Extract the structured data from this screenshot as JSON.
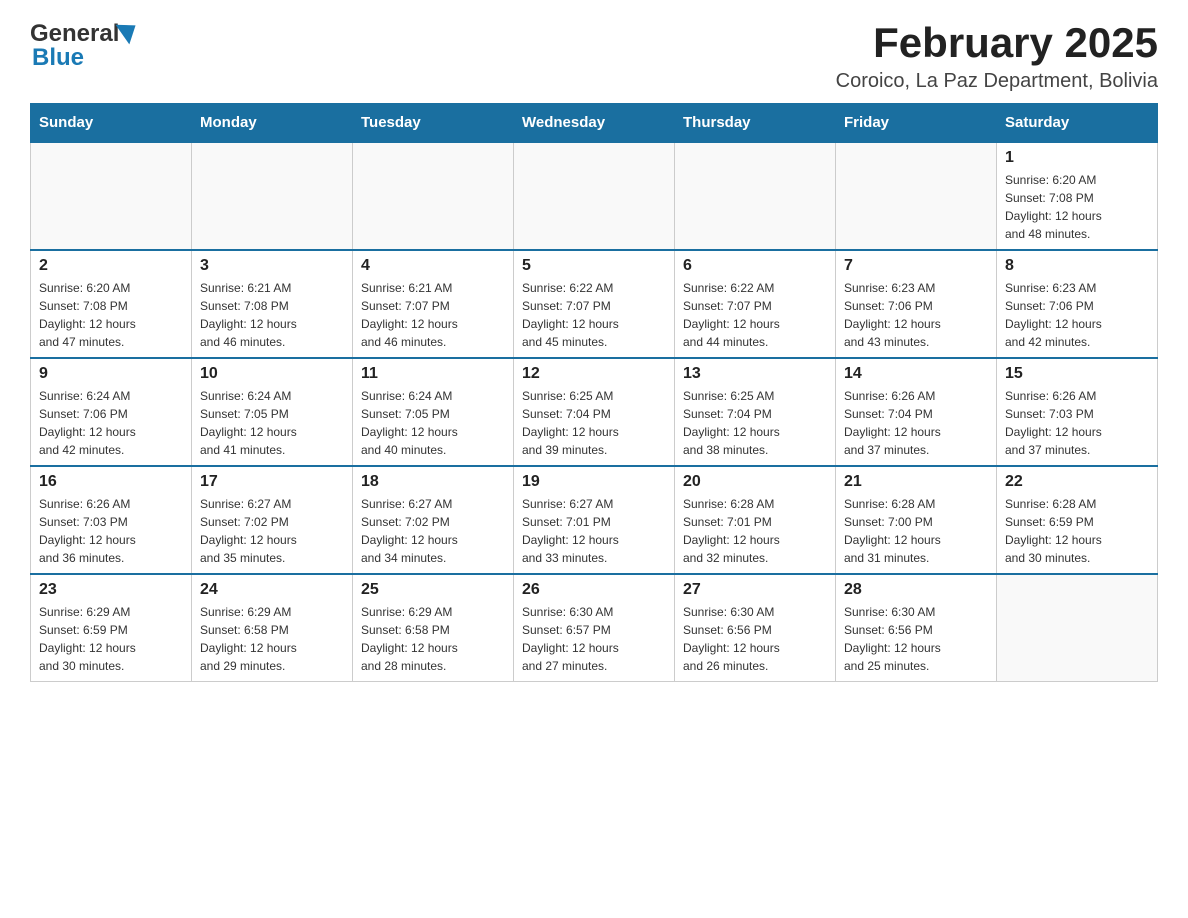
{
  "header": {
    "title": "February 2025",
    "subtitle": "Coroico, La Paz Department, Bolivia"
  },
  "logo": {
    "general": "General",
    "blue": "Blue"
  },
  "days_of_week": [
    "Sunday",
    "Monday",
    "Tuesday",
    "Wednesday",
    "Thursday",
    "Friday",
    "Saturday"
  ],
  "weeks": [
    {
      "days": [
        {
          "number": "",
          "info": ""
        },
        {
          "number": "",
          "info": ""
        },
        {
          "number": "",
          "info": ""
        },
        {
          "number": "",
          "info": ""
        },
        {
          "number": "",
          "info": ""
        },
        {
          "number": "",
          "info": ""
        },
        {
          "number": "1",
          "info": "Sunrise: 6:20 AM\nSunset: 7:08 PM\nDaylight: 12 hours\nand 48 minutes."
        }
      ]
    },
    {
      "days": [
        {
          "number": "2",
          "info": "Sunrise: 6:20 AM\nSunset: 7:08 PM\nDaylight: 12 hours\nand 47 minutes."
        },
        {
          "number": "3",
          "info": "Sunrise: 6:21 AM\nSunset: 7:08 PM\nDaylight: 12 hours\nand 46 minutes."
        },
        {
          "number": "4",
          "info": "Sunrise: 6:21 AM\nSunset: 7:07 PM\nDaylight: 12 hours\nand 46 minutes."
        },
        {
          "number": "5",
          "info": "Sunrise: 6:22 AM\nSunset: 7:07 PM\nDaylight: 12 hours\nand 45 minutes."
        },
        {
          "number": "6",
          "info": "Sunrise: 6:22 AM\nSunset: 7:07 PM\nDaylight: 12 hours\nand 44 minutes."
        },
        {
          "number": "7",
          "info": "Sunrise: 6:23 AM\nSunset: 7:06 PM\nDaylight: 12 hours\nand 43 minutes."
        },
        {
          "number": "8",
          "info": "Sunrise: 6:23 AM\nSunset: 7:06 PM\nDaylight: 12 hours\nand 42 minutes."
        }
      ]
    },
    {
      "days": [
        {
          "number": "9",
          "info": "Sunrise: 6:24 AM\nSunset: 7:06 PM\nDaylight: 12 hours\nand 42 minutes."
        },
        {
          "number": "10",
          "info": "Sunrise: 6:24 AM\nSunset: 7:05 PM\nDaylight: 12 hours\nand 41 minutes."
        },
        {
          "number": "11",
          "info": "Sunrise: 6:24 AM\nSunset: 7:05 PM\nDaylight: 12 hours\nand 40 minutes."
        },
        {
          "number": "12",
          "info": "Sunrise: 6:25 AM\nSunset: 7:04 PM\nDaylight: 12 hours\nand 39 minutes."
        },
        {
          "number": "13",
          "info": "Sunrise: 6:25 AM\nSunset: 7:04 PM\nDaylight: 12 hours\nand 38 minutes."
        },
        {
          "number": "14",
          "info": "Sunrise: 6:26 AM\nSunset: 7:04 PM\nDaylight: 12 hours\nand 37 minutes."
        },
        {
          "number": "15",
          "info": "Sunrise: 6:26 AM\nSunset: 7:03 PM\nDaylight: 12 hours\nand 37 minutes."
        }
      ]
    },
    {
      "days": [
        {
          "number": "16",
          "info": "Sunrise: 6:26 AM\nSunset: 7:03 PM\nDaylight: 12 hours\nand 36 minutes."
        },
        {
          "number": "17",
          "info": "Sunrise: 6:27 AM\nSunset: 7:02 PM\nDaylight: 12 hours\nand 35 minutes."
        },
        {
          "number": "18",
          "info": "Sunrise: 6:27 AM\nSunset: 7:02 PM\nDaylight: 12 hours\nand 34 minutes."
        },
        {
          "number": "19",
          "info": "Sunrise: 6:27 AM\nSunset: 7:01 PM\nDaylight: 12 hours\nand 33 minutes."
        },
        {
          "number": "20",
          "info": "Sunrise: 6:28 AM\nSunset: 7:01 PM\nDaylight: 12 hours\nand 32 minutes."
        },
        {
          "number": "21",
          "info": "Sunrise: 6:28 AM\nSunset: 7:00 PM\nDaylight: 12 hours\nand 31 minutes."
        },
        {
          "number": "22",
          "info": "Sunrise: 6:28 AM\nSunset: 6:59 PM\nDaylight: 12 hours\nand 30 minutes."
        }
      ]
    },
    {
      "days": [
        {
          "number": "23",
          "info": "Sunrise: 6:29 AM\nSunset: 6:59 PM\nDaylight: 12 hours\nand 30 minutes."
        },
        {
          "number": "24",
          "info": "Sunrise: 6:29 AM\nSunset: 6:58 PM\nDaylight: 12 hours\nand 29 minutes."
        },
        {
          "number": "25",
          "info": "Sunrise: 6:29 AM\nSunset: 6:58 PM\nDaylight: 12 hours\nand 28 minutes."
        },
        {
          "number": "26",
          "info": "Sunrise: 6:30 AM\nSunset: 6:57 PM\nDaylight: 12 hours\nand 27 minutes."
        },
        {
          "number": "27",
          "info": "Sunrise: 6:30 AM\nSunset: 6:56 PM\nDaylight: 12 hours\nand 26 minutes."
        },
        {
          "number": "28",
          "info": "Sunrise: 6:30 AM\nSunset: 6:56 PM\nDaylight: 12 hours\nand 25 minutes."
        },
        {
          "number": "",
          "info": ""
        }
      ]
    }
  ]
}
